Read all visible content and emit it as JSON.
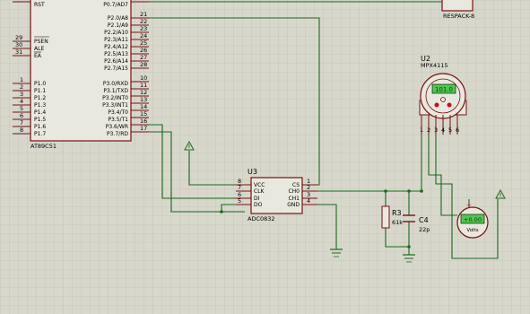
{
  "mcu": {
    "ref": "AT89C51",
    "left_pins": [
      {
        "num": "9",
        "name": "RST"
      },
      {
        "num": "29",
        "name": "PSEN"
      },
      {
        "num": "30",
        "name": "ALE"
      },
      {
        "num": "31",
        "name": "EA"
      },
      {
        "num": "1",
        "name": "P1.0"
      },
      {
        "num": "2",
        "name": "P1.1"
      },
      {
        "num": "3",
        "name": "P1.2"
      },
      {
        "num": "4",
        "name": "P1.3"
      },
      {
        "num": "5",
        "name": "P1.4"
      },
      {
        "num": "6",
        "name": "P1.5"
      },
      {
        "num": "7",
        "name": "P1.6"
      },
      {
        "num": "8",
        "name": "P1.7"
      }
    ],
    "right_pins": [
      {
        "num": "32",
        "name": "P0.7/AD7"
      },
      {
        "num": "21",
        "name": "P2.0/A8"
      },
      {
        "num": "22",
        "name": "P2.1/A9"
      },
      {
        "num": "23",
        "name": "P2.2/A10"
      },
      {
        "num": "24",
        "name": "P2.3/A11"
      },
      {
        "num": "25",
        "name": "P2.4/A12"
      },
      {
        "num": "26",
        "name": "P2.5/A13"
      },
      {
        "num": "27",
        "name": "P2.6/A14"
      },
      {
        "num": "28",
        "name": "P2.7/A15"
      },
      {
        "num": "10",
        "name": "P3.0/RXD"
      },
      {
        "num": "11",
        "name": "P3.1/TXD"
      },
      {
        "num": "12",
        "name": "P3.2/INT0"
      },
      {
        "num": "13",
        "name": "P3.3/INT1"
      },
      {
        "num": "14",
        "name": "P3.4/T0"
      },
      {
        "num": "15",
        "name": "P3.5/T1"
      },
      {
        "num": "16",
        "name": "P3.6/WR"
      },
      {
        "num": "17",
        "name": "P3.7/RD"
      }
    ]
  },
  "respack": {
    "ref": "RESPACK-8"
  },
  "adc": {
    "ref": "U3",
    "part": "ADC0832",
    "left_pins": [
      {
        "num": "8",
        "name": "VCC"
      },
      {
        "num": "7",
        "name": "CLK"
      },
      {
        "num": "6",
        "name": "DI"
      },
      {
        "num": "5",
        "name": "DO"
      }
    ],
    "right_pins": [
      {
        "num": "1",
        "name": "CS"
      },
      {
        "num": "2",
        "name": "CH0"
      },
      {
        "num": "3",
        "name": "CH1"
      },
      {
        "num": "4",
        "name": "GND"
      }
    ]
  },
  "sensor": {
    "ref": "U2",
    "part": "MPX4115",
    "display": "101.0",
    "pins": [
      "1",
      "2",
      "3",
      "4",
      "5",
      "6"
    ]
  },
  "r3": {
    "ref": "R3",
    "value": "61k"
  },
  "c4": {
    "ref": "C4",
    "value": "22p"
  },
  "meter": {
    "display": "+0.00",
    "label": "Volts"
  },
  "colors": {
    "background": "#d7d7cc",
    "grid": "#bdbdb0",
    "wire": "#1a6a1a",
    "component_outline": "#7a1010",
    "lcd_green": "#4fc84f"
  }
}
